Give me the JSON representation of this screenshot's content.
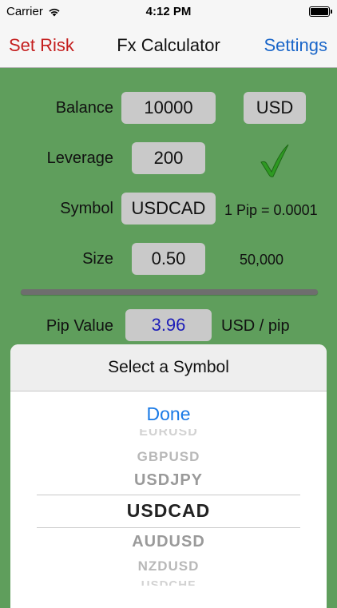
{
  "status": {
    "carrier": "Carrier",
    "time": "4:12 PM"
  },
  "nav": {
    "left": "Set Risk",
    "title": "Fx Calculator",
    "right": "Settings"
  },
  "form": {
    "balance_label": "Balance",
    "balance_value": "10000",
    "currency": "USD",
    "leverage_label": "Leverage",
    "leverage_value": "200",
    "symbol_label": "Symbol",
    "symbol_value": "USDCAD",
    "pip_text": "1 Pip = 0.0001",
    "size_label": "Size",
    "size_value": "0.50",
    "units": "50,000",
    "pip_value_label": "Pip Value",
    "pip_value": "3.96",
    "pip_value_unit": "USD / pip"
  },
  "sheet": {
    "title": "Select a Symbol",
    "done": "Done",
    "options": [
      "EURUSD",
      "GBPUSD",
      "USDJPY",
      "USDCAD",
      "AUDUSD",
      "NZDUSD",
      "USDCHF"
    ],
    "selected": "USDCAD"
  },
  "colors": {
    "background": "#5f9e5c",
    "accent_red": "#c41e1e",
    "accent_blue": "#1a66c9",
    "check_green": "#2e9a22",
    "pip_value_color": "#1c1cb8"
  }
}
